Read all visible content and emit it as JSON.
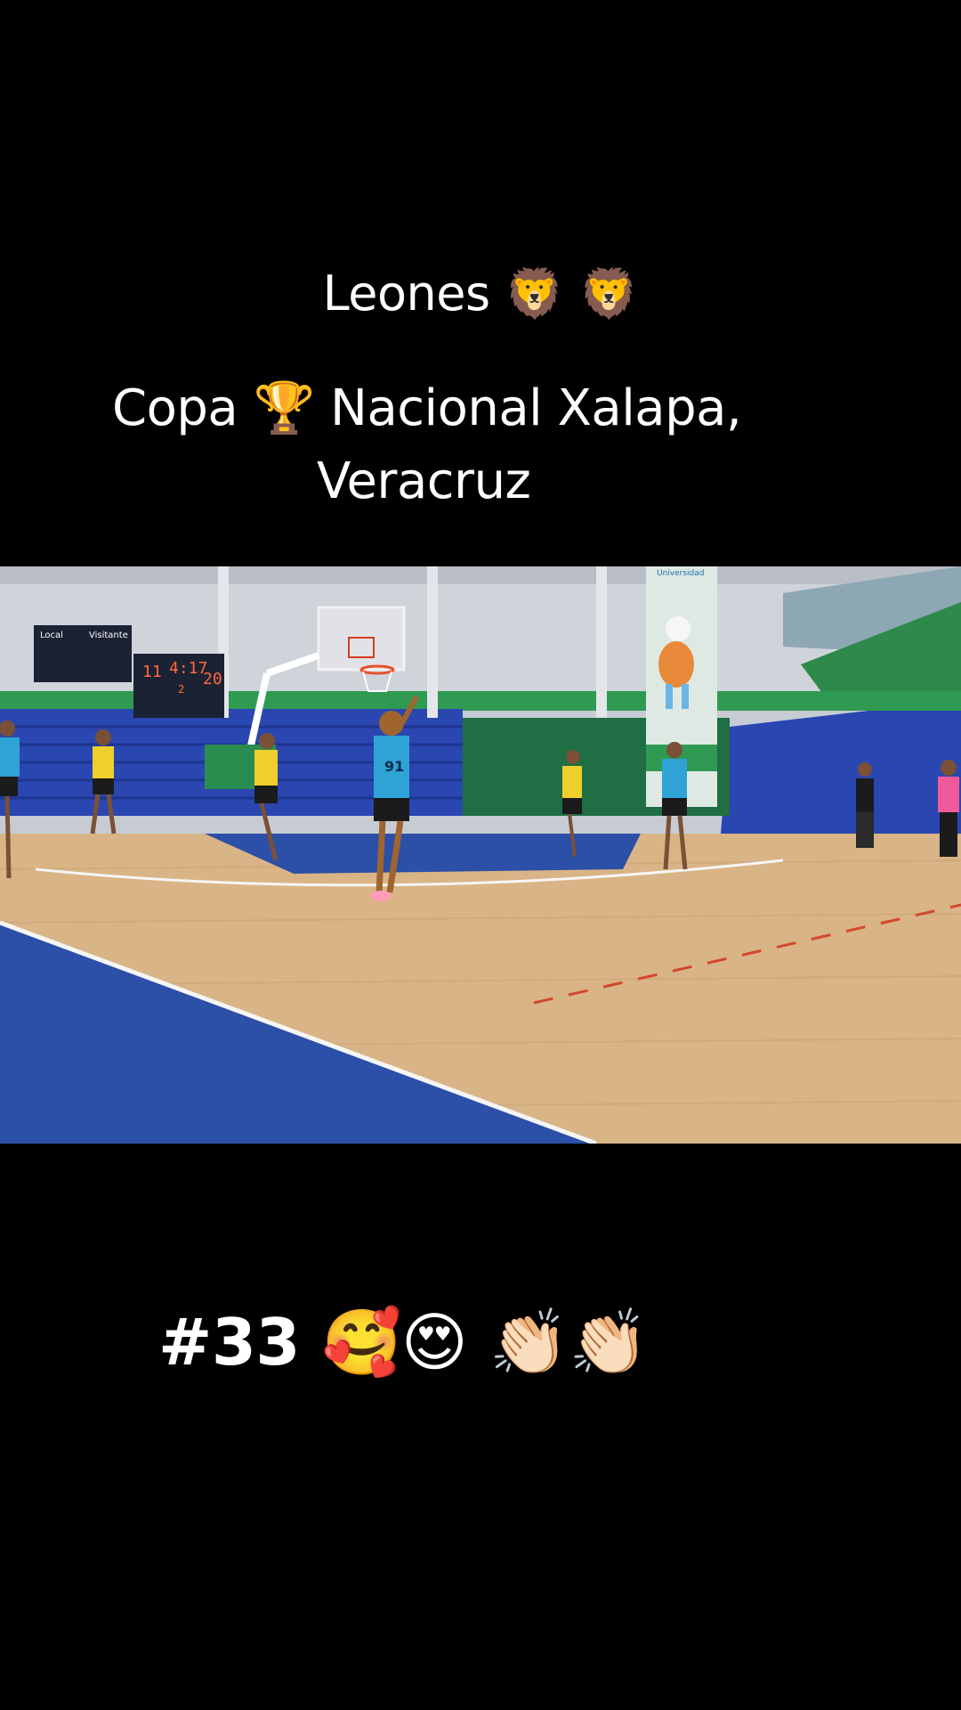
{
  "overlay": {
    "title": "Leones 🦁 🦁",
    "subtitle_line1": "Copa 🏆 Nacional Xalapa,",
    "subtitle_line2": "Veracruz",
    "hashtag": "#33 🥰😍 👏🏻👏🏻"
  },
  "video": {
    "scoreboard": {
      "home_label": "Local",
      "away_label": "Visitante",
      "home_score": "11",
      "clock": "4:17",
      "away_score": "20",
      "period": "2"
    },
    "banner_text": "Universidad",
    "player_number": "91"
  },
  "colors": {
    "court_wood": "#d9b486",
    "court_blue": "#2c4fa8",
    "seats_blue": "#2a46b0",
    "team_yellow": "#f1cf2a",
    "team_cyan": "#2fa3d6"
  }
}
